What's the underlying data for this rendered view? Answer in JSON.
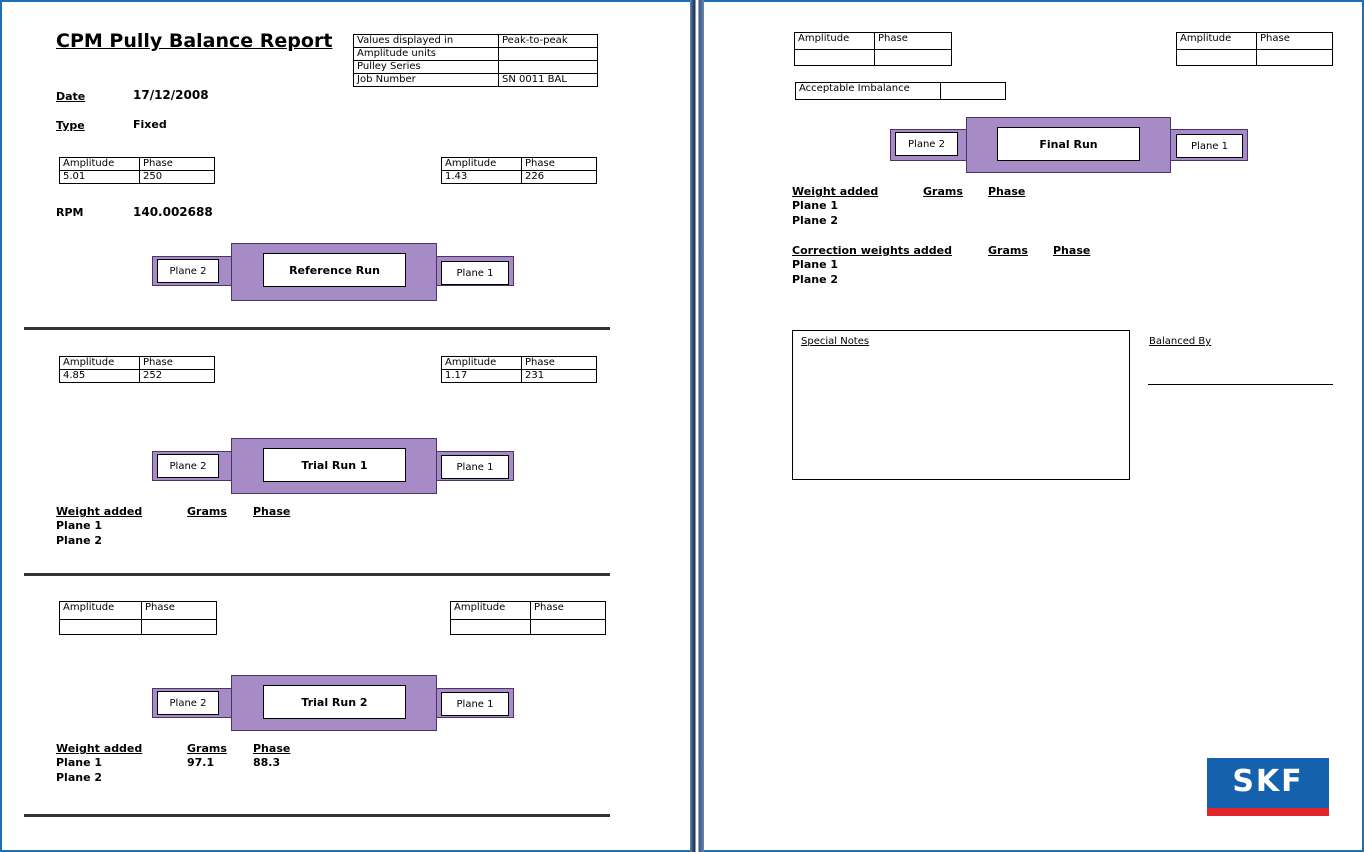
{
  "report": {
    "title": "CPM Pully Balance Report",
    "date_label": "Date",
    "date_value": "17/12/2008",
    "type_label": "Type",
    "type_value": "Fixed",
    "rpm_label": "RPM",
    "rpm_value": "140.002688"
  },
  "info_table": {
    "rows": [
      [
        "Values displayed in",
        "Peak-to-peak"
      ],
      [
        "Amplitude units",
        ""
      ],
      [
        "Pulley Series",
        ""
      ],
      [
        "Job Number",
        "SN 0011 BAL"
      ]
    ]
  },
  "headers": {
    "amplitude": "Amplitude",
    "phase": "Phase"
  },
  "reference_run": {
    "left": {
      "amplitude": "5.01",
      "phase": "250"
    },
    "right": {
      "amplitude": "1.43",
      "phase": "226"
    },
    "run_label": "Reference Run",
    "plane2": "Plane 2",
    "plane1": "Plane 1"
  },
  "trial_run_1": {
    "left": {
      "amplitude": "4.85",
      "phase": "252"
    },
    "right": {
      "amplitude": "1.17",
      "phase": "231"
    },
    "run_label": "Trial Run 1",
    "plane2": "Plane 2",
    "plane1": "Plane 1",
    "weight_added": "Weight added",
    "grams": "Grams",
    "phase": "Phase",
    "plane1_label": "Plane 1",
    "plane2_label": "Plane 2"
  },
  "trial_run_2": {
    "left": {
      "amplitude": "",
      "phase": ""
    },
    "right": {
      "amplitude": "",
      "phase": ""
    },
    "run_label": "Trial Run 2",
    "plane2": "Plane 2",
    "plane1": "Plane 1",
    "weight_added": "Weight added",
    "grams": "Grams",
    "phase": "Phase",
    "plane1_label": "Plane 1",
    "plane1_grams": "97.1",
    "plane1_phase": "88.3",
    "plane2_label": "Plane 2"
  },
  "final_run": {
    "left": {
      "amplitude": "",
      "phase": ""
    },
    "right": {
      "amplitude": "",
      "phase": ""
    },
    "acceptable_imbalance_label": "Acceptable Imbalance",
    "acceptable_imbalance_value": "",
    "run_label": "Final Run",
    "plane2": "Plane 2",
    "plane1": "Plane 1",
    "weight_added": "Weight added",
    "grams": "Grams",
    "phase": "Phase",
    "plane1_label": "Plane 1",
    "plane2_label": "Plane 2",
    "correction_label": "Correction weights added",
    "corr_grams": "Grams",
    "corr_phase": "Phase",
    "corr_plane1_label": "Plane 1",
    "corr_plane2_label": "Plane 2"
  },
  "notes": {
    "special_notes": "Special Notes",
    "balanced_by": "Balanced By"
  },
  "logo": {
    "text": "SKF",
    "blue": "#1561ae",
    "red": "#e0262a"
  },
  "colors": {
    "rotor": "#a78bc6",
    "frame": "#1f6fb7"
  }
}
